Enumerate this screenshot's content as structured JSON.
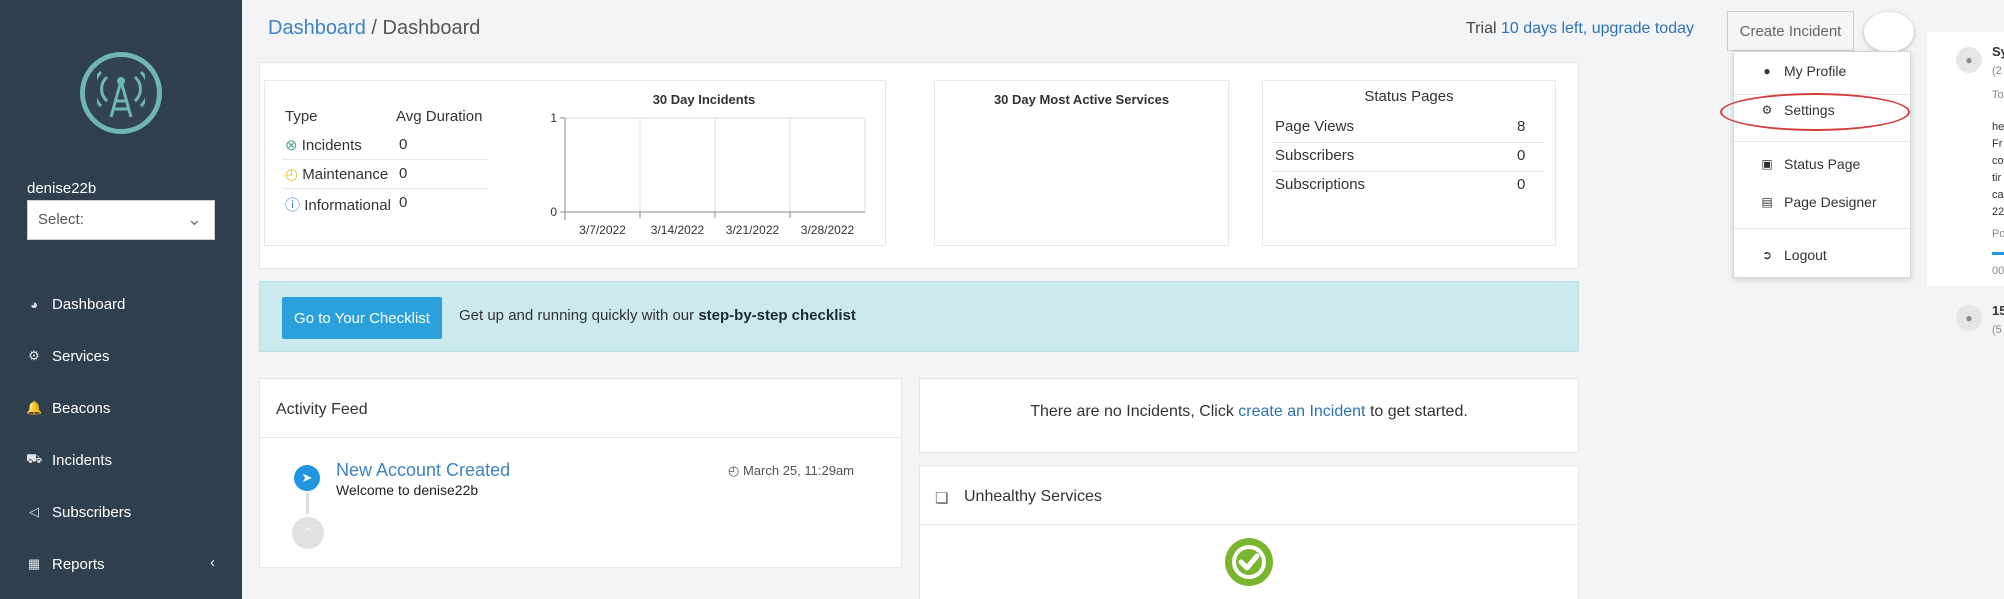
{
  "colors": {
    "sidebar_bg": "#2f3f4d",
    "accent_link": "#3f83c3",
    "checklist_bg": "#cce9ee",
    "primary_button": "#2aa1db",
    "ok_green": "#7ab52f",
    "highlight_red": "#d33f3f"
  },
  "sidebar": {
    "username": "denise22b",
    "select_value": "Select:",
    "items": [
      {
        "label": "Dashboard",
        "icon": "pie-chart-icon"
      },
      {
        "label": "Services",
        "icon": "cogs-icon"
      },
      {
        "label": "Beacons",
        "icon": "bell-icon"
      },
      {
        "label": "Incidents",
        "icon": "ambulance-icon"
      },
      {
        "label": "Subscribers",
        "icon": "megaphone-icon"
      },
      {
        "label": "Reports",
        "icon": "grid-icon"
      }
    ]
  },
  "header": {
    "breadcrumb_link": "Dashboard",
    "breadcrumb_sep": " / ",
    "breadcrumb_current": "Dashboard",
    "trial_prefix": "Trial",
    "trial_link": "10 days left, upgrade today",
    "create_incident": "Create Incident"
  },
  "incidents_summary": {
    "col_type": "Type",
    "col_avg": "Avg Duration",
    "rows": [
      {
        "type": "Incidents",
        "value": "0"
      },
      {
        "type": "Maintenance",
        "value": "0"
      },
      {
        "type": "Informational",
        "value": "0"
      }
    ]
  },
  "chart_data": {
    "type": "line",
    "title": "30 Day Incidents",
    "x": [
      "3/7/2022",
      "3/14/2022",
      "3/21/2022",
      "3/28/2022"
    ],
    "y_ticks": [
      "1",
      "0"
    ],
    "ylim": [
      0,
      1
    ],
    "series": [],
    "grid": true
  },
  "most_active": {
    "title": "30 Day Most Active Services"
  },
  "status_pages": {
    "title": "Status Pages",
    "rows": [
      {
        "label": "Page Views",
        "value": "8"
      },
      {
        "label": "Subscribers",
        "value": "0"
      },
      {
        "label": "Subscriptions",
        "value": "0"
      }
    ]
  },
  "checklist": {
    "button": "Go to Your Checklist",
    "text": "Get up and running quickly with our ",
    "bold": "step-by-step checklist"
  },
  "activity_feed": {
    "title": "Activity Feed",
    "headline": "New Account Created",
    "subtitle": "Welcome to denise22b",
    "time": "March 25, 11:29am"
  },
  "no_incidents": {
    "prefix": "There are no Incidents, Click ",
    "link": "create an Incident",
    "suffix": " to get started."
  },
  "unhealthy": {
    "title": "Unhealthy Services"
  },
  "profile_menu": {
    "items": [
      {
        "label": "My Profile",
        "icon": "user-icon"
      },
      {
        "label": "Settings",
        "icon": "cogs-icon"
      },
      {
        "label": "Status Page",
        "icon": "monitor-icon"
      },
      {
        "label": "Page Designer",
        "icon": "layout-icon"
      },
      {
        "label": "Logout",
        "icon": "sign-out-icon"
      }
    ]
  },
  "right_panel": {
    "line1": "Sy",
    "line2": "(2",
    "line3": "To",
    "body": [
      "he",
      "Fr",
      "co",
      "tir",
      "ca",
      "22"
    ],
    "line_p": "Po",
    "line_00": "00",
    "line_15": "15",
    "line_5": "(5"
  }
}
